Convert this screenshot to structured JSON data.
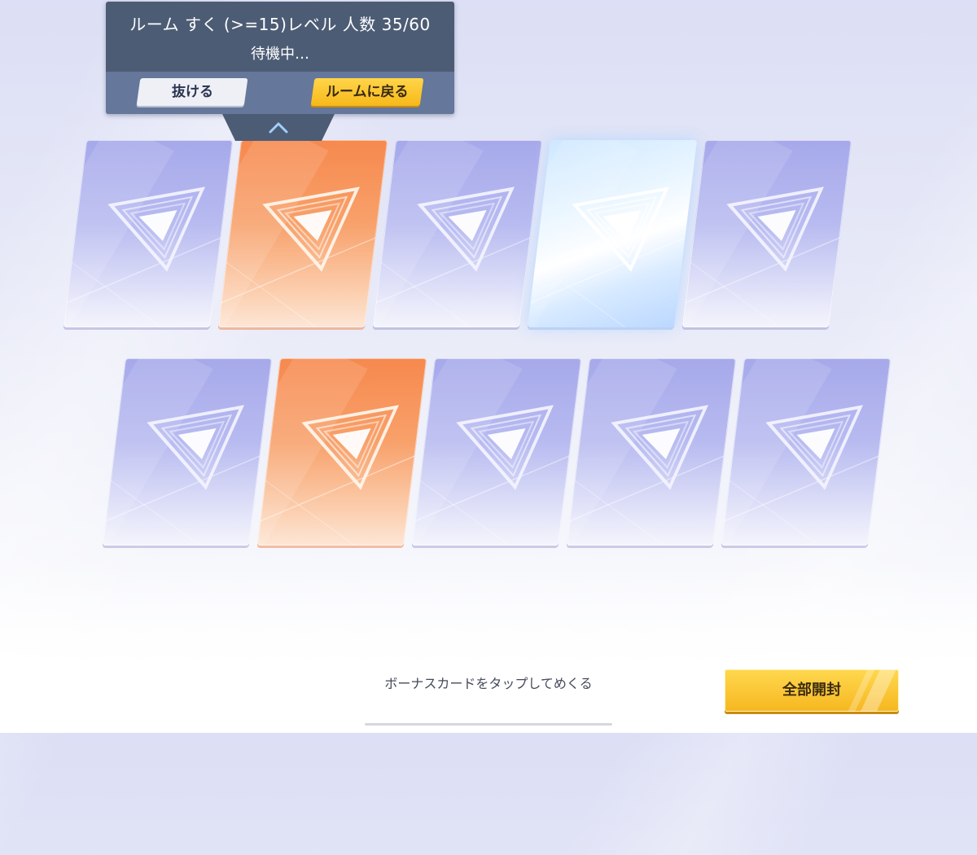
{
  "room_panel": {
    "room_line": "ルーム すく (>=15)レベル 人数 35/60",
    "status": "待機中…",
    "leave_label": "抜ける",
    "return_label": "ルームに戻る",
    "collapse_icon": "chevron-up-icon"
  },
  "cards": {
    "row1": [
      {
        "variant": "purple"
      },
      {
        "variant": "orange"
      },
      {
        "variant": "purple"
      },
      {
        "variant": "shine"
      },
      {
        "variant": "purple"
      }
    ],
    "row2": [
      {
        "variant": "purple"
      },
      {
        "variant": "orange"
      },
      {
        "variant": "purple"
      },
      {
        "variant": "purple"
      },
      {
        "variant": "purple"
      }
    ]
  },
  "footer": {
    "instruction": "ボーナスカードをタップしてめくる",
    "open_all_label": "全部開封"
  },
  "colors": {
    "card_purple": "#a6a9ea",
    "card_orange": "#f6894e",
    "button_yellow": "#ffd54a",
    "panel_bg": "#4d5c75"
  }
}
